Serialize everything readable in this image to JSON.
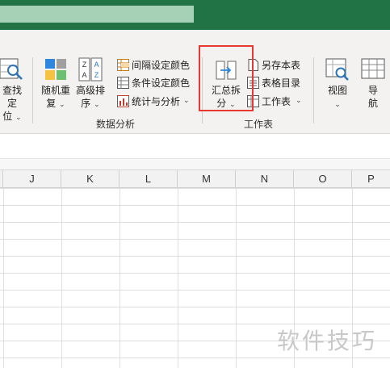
{
  "ribbon": {
    "find": {
      "line1": "查找定",
      "line2": "位"
    },
    "random": {
      "line1": "随机重",
      "line2": "复"
    },
    "sort": {
      "line1": "高级排",
      "line2": "序"
    },
    "interval_color": "间隔设定颜色",
    "condition_color": "条件设定颜色",
    "stats": "统计与分析",
    "group_data_analysis": "数据分析",
    "merge_split": {
      "line1": "汇总拆",
      "line2": "分"
    },
    "save_as": "另存本表",
    "sheet_dir": "表格目录",
    "worksheet": "工作表",
    "group_worksheet": "工作表",
    "view": "视图",
    "nav": {
      "line1": "导",
      "line2": "航"
    }
  },
  "columns": [
    "J",
    "K",
    "L",
    "M",
    "N",
    "O",
    "P"
  ],
  "watermark": "软件技巧",
  "colors": {
    "title_bar": "#217346",
    "highlight_box": "#e8382f",
    "ribbon_bg": "#f3f2f1"
  }
}
